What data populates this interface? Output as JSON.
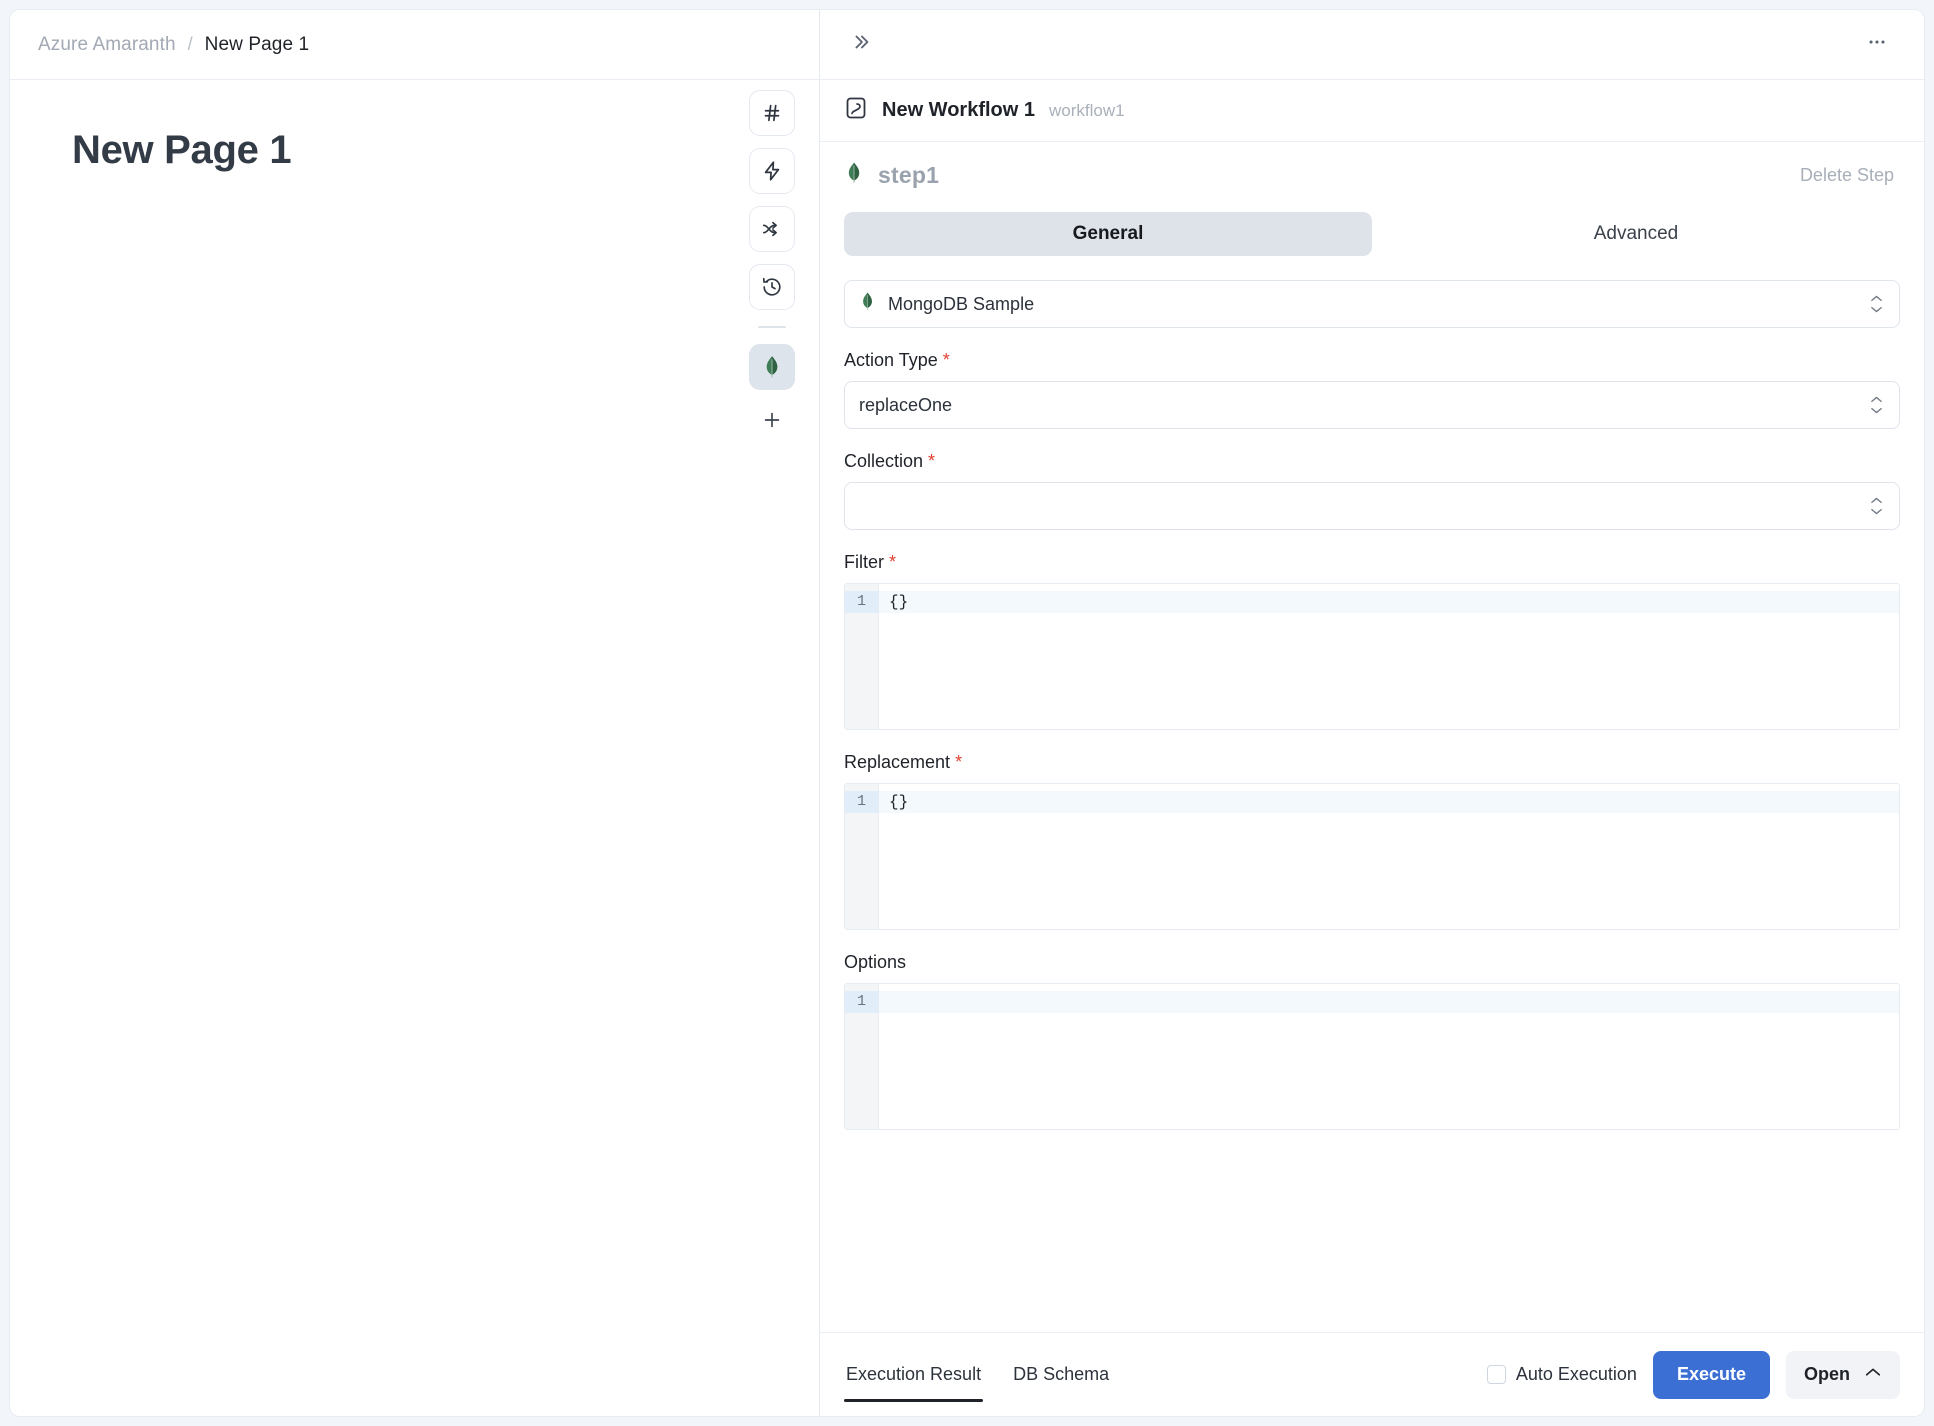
{
  "breadcrumb": {
    "root": "Azure Amaranth",
    "separator": "/",
    "current": "New Page 1"
  },
  "canvas": {
    "page_title": "New Page 1",
    "rail": {
      "items": [
        {
          "icon": "hash-icon",
          "label": "#"
        },
        {
          "icon": "lightning-icon",
          "label": ""
        },
        {
          "icon": "branch-arrows-icon",
          "label": ""
        },
        {
          "icon": "history-clock-icon",
          "label": ""
        },
        {
          "icon": "mongodb-leaf-icon",
          "label": "",
          "active": true
        }
      ],
      "add_label": "+"
    }
  },
  "workflow": {
    "collapse_icon": "double-chevron-right-icon",
    "more_icon": "ellipsis-icon",
    "icon": "workflow-icon",
    "name": "New Workflow 1",
    "slug": "workflow1"
  },
  "step": {
    "icon": "mongodb-leaf-icon",
    "name": "step1",
    "delete_label": "Delete Step"
  },
  "tabs": [
    {
      "label": "General",
      "active": true
    },
    {
      "label": "Advanced",
      "active": false
    }
  ],
  "form": {
    "datasource": {
      "icon": "mongodb-leaf-icon",
      "value": "MongoDB Sample"
    },
    "action_type": {
      "label": "Action Type",
      "required": true,
      "value": "replaceOne"
    },
    "collection": {
      "label": "Collection",
      "required": true,
      "value": ""
    },
    "filter": {
      "label": "Filter",
      "required": true,
      "line_number": "1",
      "code": "{}"
    },
    "replacement": {
      "label": "Replacement",
      "required": true,
      "line_number": "1",
      "code": "{}"
    },
    "options": {
      "label": "Options",
      "required": false,
      "line_number": "1",
      "code": ""
    }
  },
  "bottom": {
    "tabs": [
      {
        "label": "Execution Result",
        "active": true
      },
      {
        "label": "DB Schema",
        "active": false
      }
    ],
    "auto_execution_label": "Auto Execution",
    "auto_execution_checked": false,
    "execute_label": "Execute",
    "open_label": "Open",
    "open_icon": "chevron-up-icon"
  },
  "colors": {
    "accent_blue": "#3b6fd4",
    "mongodb_green": "#3f7d57",
    "required_red": "#e0402f",
    "tab_active_bg": "#dee3ea"
  }
}
